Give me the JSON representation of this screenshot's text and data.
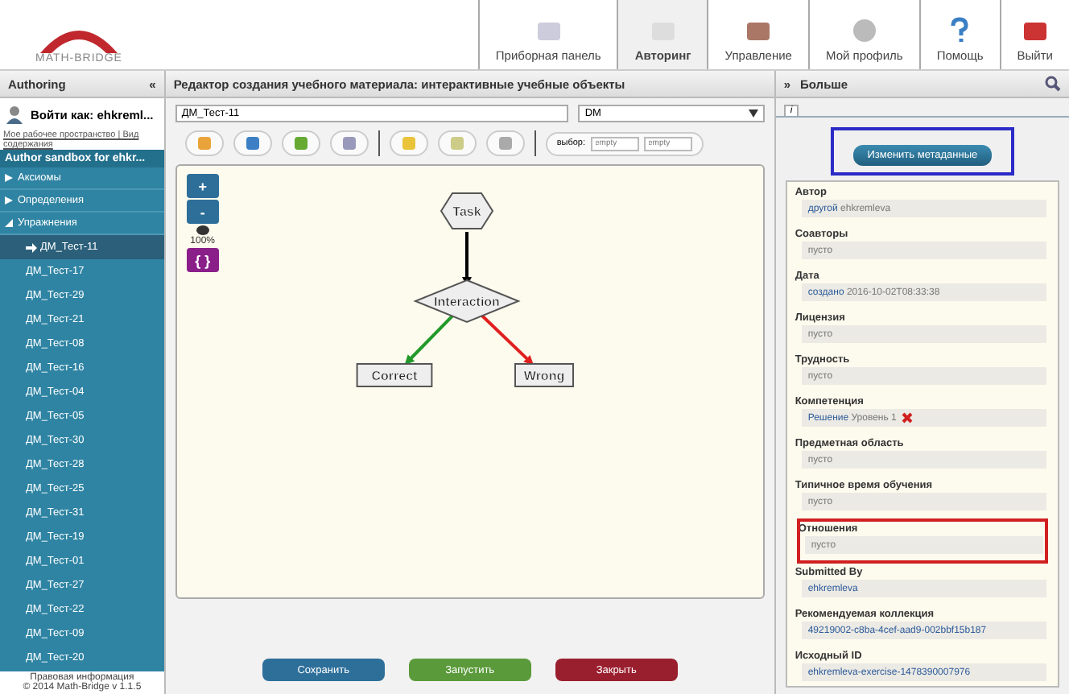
{
  "header": {
    "logo": "MATH-BRIDGE",
    "nav": [
      {
        "label": "Приборная панель",
        "selected": false
      },
      {
        "label": "Авторинг",
        "selected": true
      },
      {
        "label": "Управление",
        "selected": false
      },
      {
        "label": "Мой профиль",
        "selected": false
      },
      {
        "label": "Помощь",
        "selected": false
      },
      {
        "label": "Выйти",
        "selected": false
      }
    ]
  },
  "sidebar": {
    "title": "Authoring",
    "collapse": "«",
    "user": "Войти как: ehkreml...",
    "links": "Мое рабочее пространство | Вид содержания",
    "root": "Author sandbox for ehkr...",
    "tree": [
      {
        "label": "Аксиомы",
        "expanded": false
      },
      {
        "label": "Определения",
        "expanded": false
      },
      {
        "label": "Упражнения",
        "expanded": true,
        "children": [
          {
            "label": "ДМ_Тест-11",
            "selected": true
          },
          {
            "label": "ДМ_Тест-17",
            "selected": false
          },
          {
            "label": "ДМ_Тест-29",
            "selected": false
          },
          {
            "label": "ДМ_Тест-21",
            "selected": false
          },
          {
            "label": "ДМ_Тест-08",
            "selected": false
          },
          {
            "label": "ДМ_Тест-16",
            "selected": false
          },
          {
            "label": "ДМ_Тест-04",
            "selected": false
          },
          {
            "label": "ДМ_Тест-05",
            "selected": false
          },
          {
            "label": "ДМ_Тест-30",
            "selected": false
          },
          {
            "label": "ДМ_Тест-28",
            "selected": false
          },
          {
            "label": "ДМ_Тест-25",
            "selected": false
          },
          {
            "label": "ДМ_Тест-31",
            "selected": false
          },
          {
            "label": "ДМ_Тест-19",
            "selected": false
          },
          {
            "label": "ДМ_Тест-01",
            "selected": false
          },
          {
            "label": "ДМ_Тест-27",
            "selected": false
          },
          {
            "label": "ДМ_Тест-22",
            "selected": false
          },
          {
            "label": "ДМ_Тест-09",
            "selected": false
          },
          {
            "label": "ДМ_Тест-20",
            "selected": false
          }
        ]
      }
    ],
    "footer": [
      "Правовая информация",
      "© 2014 Math-Bridge v 1.1.5"
    ]
  },
  "editor": {
    "title": "Редактор создания учебного материала: интерактивные учебные объекты",
    "name": "ДМ_Тест-11",
    "language": "DM",
    "selection_label": "выбор:",
    "selection_fields": [
      {
        "placeholder": "empty"
      },
      {
        "placeholder": "empty"
      }
    ],
    "zoom": {
      "plus": "+",
      "minus": "-",
      "level": "100%",
      "braces": "{ }"
    },
    "nodes": [
      {
        "label": "Task",
        "kind": "hexagon"
      },
      {
        "label": "Interaction",
        "kind": "diamond"
      },
      {
        "label": "Correct",
        "kind": "box"
      },
      {
        "label": "Wrong",
        "kind": "box"
      }
    ],
    "edges": [
      {
        "color": "#000000"
      },
      {
        "color": "#22992a"
      },
      {
        "color": "#e02020"
      }
    ],
    "buttons": [
      {
        "label": "Сохранить",
        "color": "#2e6f9a"
      },
      {
        "label": "Запустить",
        "color": "#5a9a3a"
      },
      {
        "label": "Закрыть",
        "color": "#9a1f2e"
      }
    ]
  },
  "panel": {
    "expand": "»",
    "title": "Больше",
    "tab": "i",
    "button": {
      "label": "Изменить метаданные",
      "highlighted": true
    },
    "fields": [
      {
        "label": "Автор",
        "qualifier": "другой",
        "text": "ehkremleva",
        "link": false,
        "removable": false,
        "highlighted": false
      },
      {
        "label": "Соавторы",
        "value": "пусто",
        "link": false,
        "removable": false,
        "highlighted": false
      },
      {
        "label": "Дата",
        "qualifier": "создано",
        "text": "2016-10-02T08:33:38",
        "link": false,
        "removable": false,
        "highlighted": false
      },
      {
        "label": "Лицензия",
        "value": "пусто",
        "link": false,
        "removable": false,
        "highlighted": false
      },
      {
        "label": "Трудность",
        "value": "пусто",
        "link": false,
        "removable": false,
        "highlighted": false
      },
      {
        "label": "Компетенция",
        "qualifier": "Решение",
        "text": "Уровень 1",
        "link": false,
        "removable": true,
        "highlighted": false
      },
      {
        "label": "Предметная область",
        "value": "пусто",
        "link": false,
        "removable": false,
        "highlighted": false
      },
      {
        "label": "Типичное время обучения",
        "value": "пусто",
        "link": false,
        "removable": false,
        "highlighted": false
      },
      {
        "label": "Отношения",
        "value": "пусто",
        "link": false,
        "removable": false,
        "highlighted": true
      },
      {
        "label": "Submitted By",
        "value": "ehkremleva",
        "link": true,
        "removable": false,
        "highlighted": false
      },
      {
        "label": "Рекомендуемая коллекция",
        "value": "49219002-c8ba-4cef-aad9-002bbf15b187",
        "link": true,
        "removable": false,
        "highlighted": false
      },
      {
        "label": "Исходный ID",
        "value": "ehkremleva-exercise-1478390007976",
        "link": true,
        "removable": false,
        "highlighted": false
      }
    ]
  }
}
